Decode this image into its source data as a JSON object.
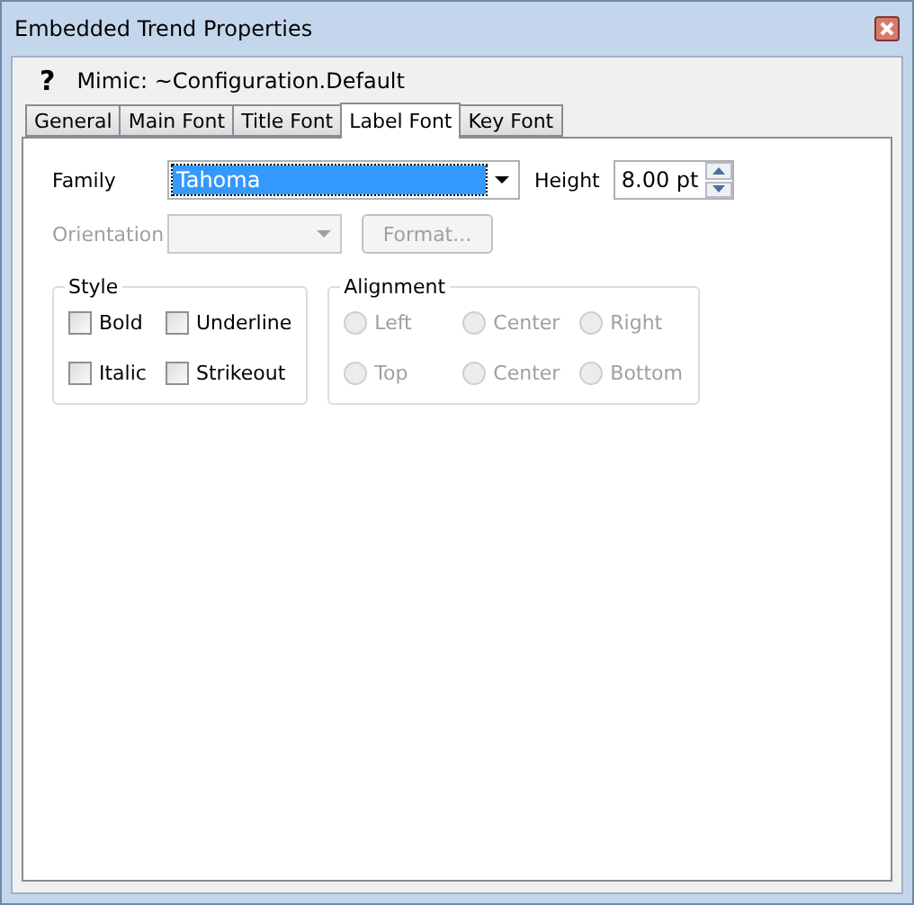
{
  "window": {
    "title": "Embedded Trend Properties"
  },
  "header": {
    "help_glyph": "?",
    "text": "Mimic: ~Configuration.Default"
  },
  "tabs": [
    {
      "label": "General",
      "selected": false
    },
    {
      "label": "Main Font",
      "selected": false
    },
    {
      "label": "Title Font",
      "selected": false
    },
    {
      "label": "Label Font",
      "selected": true
    },
    {
      "label": "Key Font",
      "selected": false
    }
  ],
  "family": {
    "label": "Family",
    "value": "Tahoma"
  },
  "height": {
    "label": "Height",
    "value": "8.00 pt"
  },
  "orientation": {
    "label": "Orientation",
    "disabled": true
  },
  "format_button": {
    "label": "Format...",
    "disabled": true
  },
  "style": {
    "title": "Style",
    "options": [
      {
        "label": "Bold",
        "checked": false
      },
      {
        "label": "Underline",
        "checked": false
      },
      {
        "label": "Italic",
        "checked": false
      },
      {
        "label": "Strikeout",
        "checked": false
      }
    ]
  },
  "alignment": {
    "title": "Alignment",
    "disabled": true,
    "options": [
      {
        "label": "Left",
        "selected": false
      },
      {
        "label": "Center",
        "selected": false
      },
      {
        "label": "Right",
        "selected": false
      },
      {
        "label": "Top",
        "selected": false
      },
      {
        "label": "Center",
        "selected": false
      },
      {
        "label": "Bottom",
        "selected": false
      }
    ]
  }
}
